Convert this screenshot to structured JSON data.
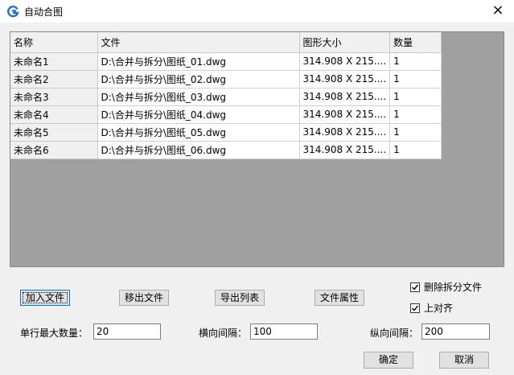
{
  "window": {
    "title": "自动合图",
    "close_glyph": "×"
  },
  "table": {
    "headers": [
      "名称",
      "文件",
      "图形大小",
      "数量"
    ],
    "rows": [
      {
        "name": "未命名1",
        "file": "D:\\合并与拆分\\图纸_01.dwg",
        "size": "314.908 X 215....",
        "count": "1"
      },
      {
        "name": "未命名2",
        "file": "D:\\合并与拆分\\图纸_02.dwg",
        "size": "314.908 X 215....",
        "count": "1"
      },
      {
        "name": "未命名3",
        "file": "D:\\合并与拆分\\图纸_03.dwg",
        "size": "314.908 X 215....",
        "count": "1"
      },
      {
        "name": "未命名4",
        "file": "D:\\合并与拆分\\图纸_04.dwg",
        "size": "314.908 X 215....",
        "count": "1"
      },
      {
        "name": "未命名5",
        "file": "D:\\合并与拆分\\图纸_05.dwg",
        "size": "314.908 X 215....",
        "count": "1"
      },
      {
        "name": "未命名6",
        "file": "D:\\合并与拆分\\图纸_06.dwg",
        "size": "314.908 X 215....",
        "count": "1"
      }
    ]
  },
  "buttons": {
    "add_file": "加入文件",
    "remove_file": "移出文件",
    "export_list": "导出列表",
    "file_props": "文件属性",
    "ok": "确定",
    "cancel": "取消"
  },
  "options": {
    "delete_split": {
      "label": "删除拆分文件",
      "checked": true
    },
    "align_top": {
      "label": "上对齐",
      "checked": true
    }
  },
  "fields": {
    "max_per_row": {
      "label": "单行最大数量：",
      "value": "20"
    },
    "h_spacing": {
      "label": "横向间隔：",
      "value": "100"
    },
    "v_spacing": {
      "label": "纵向间隔：",
      "value": "200"
    }
  },
  "colors": {
    "accent": "#0078d7",
    "grid_bg": "#a0a0a0"
  }
}
